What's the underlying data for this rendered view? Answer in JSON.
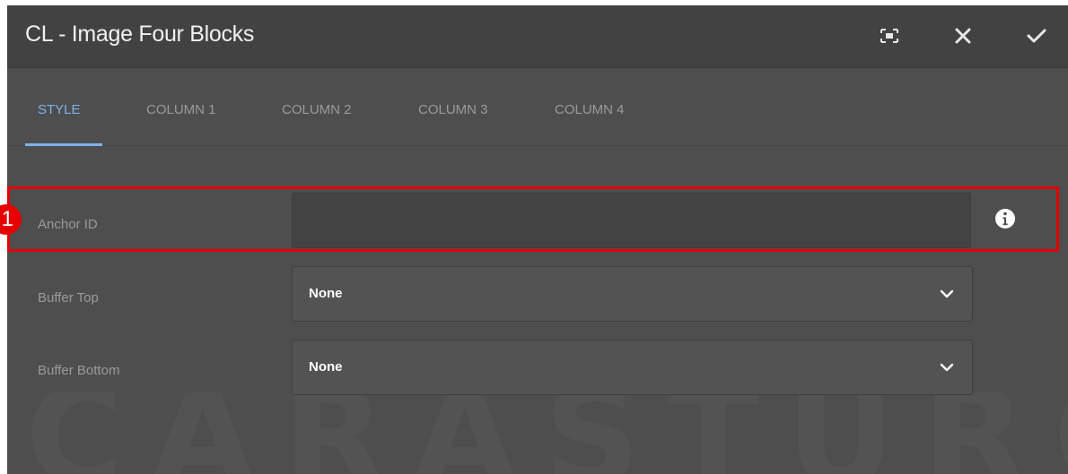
{
  "dialog": {
    "title": "CL - Image Four Blocks",
    "buttons": {
      "fullscreen_icon": "fullscreen-icon",
      "close_icon": "close-icon",
      "done_icon": "checkmark-icon"
    }
  },
  "tabs": [
    {
      "label": "STYLE",
      "active": true
    },
    {
      "label": "COLUMN 1",
      "active": false
    },
    {
      "label": "COLUMN 2",
      "active": false
    },
    {
      "label": "COLUMN 3",
      "active": false
    },
    {
      "label": "COLUMN 4",
      "active": false
    }
  ],
  "form": {
    "anchor_id": {
      "label": "Anchor ID",
      "value": "",
      "info_icon": "info-icon"
    },
    "buffer_top": {
      "label": "Buffer Top",
      "value": "None"
    },
    "buffer_bottom": {
      "label": "Buffer Bottom",
      "value": "None"
    }
  },
  "annotation": {
    "marker": "1",
    "color": "#e60000"
  },
  "watermark": {
    "text": "CARASTURO"
  },
  "colors": {
    "accent": "#7eb1ef",
    "panel": "#4e4e4e",
    "titlebar": "#424242"
  }
}
